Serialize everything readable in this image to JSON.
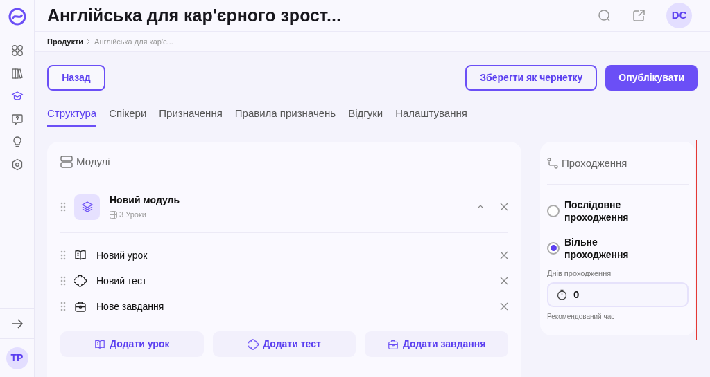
{
  "sidebar": {
    "items": [
      {
        "kind": "grid",
        "selected": false
      },
      {
        "kind": "books",
        "selected": false
      },
      {
        "kind": "cap",
        "selected": true
      },
      {
        "kind": "chat",
        "selected": false
      },
      {
        "kind": "bulb",
        "selected": false
      },
      {
        "kind": "hexagon",
        "selected": false
      }
    ],
    "user_avatar": "TP"
  },
  "header": {
    "title": "Англійська для кар'єрного зрост...",
    "avatar": "DC"
  },
  "breadcrumb": [
    "Продукти",
    "Англійська для кар'є..."
  ],
  "back_button": "Назад",
  "actions": [
    {
      "label": "Зберегти як чернетку",
      "kind": "outline"
    },
    {
      "label": "Опублікувати",
      "kind": "primary"
    }
  ],
  "tabs": [
    {
      "label": "Структура",
      "selected": true
    },
    {
      "label": "Спікери",
      "selected": false
    },
    {
      "label": "Призначення",
      "selected": false
    },
    {
      "label": "Правила призначень",
      "selected": false
    },
    {
      "label": "Відгуки",
      "selected": false
    },
    {
      "label": "Налаштування",
      "selected": false
    }
  ],
  "modules": {
    "title": "Модулі",
    "module": {
      "title": "Новий модуль",
      "count": "3 Уроки",
      "expanded": true
    },
    "items": [
      {
        "kind": "lesson",
        "title": "Новий урок"
      },
      {
        "kind": "test",
        "title": "Новий тест"
      },
      {
        "kind": "task",
        "title": "Нове завдання"
      }
    ],
    "add_buttons": [
      {
        "kind": "lesson",
        "label": "Додати урок"
      },
      {
        "kind": "test",
        "label": "Додати тест"
      },
      {
        "kind": "task",
        "label": "Додати завдання"
      }
    ]
  },
  "passage": {
    "title": "Проходження",
    "options": [
      {
        "label": "Послідовне проходження",
        "selected": false
      },
      {
        "label": "Вільне проходження",
        "selected": true
      }
    ],
    "days_label": "Днів проходження",
    "days_value": "0",
    "hint": "Рекомендований час"
  }
}
